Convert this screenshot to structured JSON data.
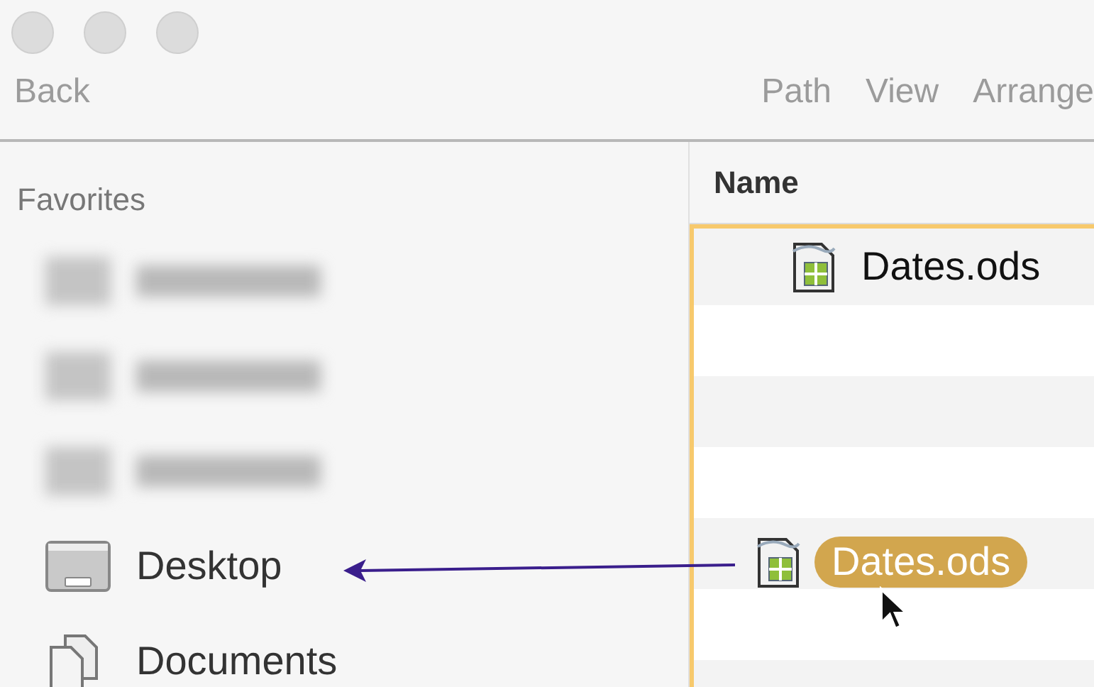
{
  "toolbar": {
    "back": "Back",
    "items": [
      "Path",
      "View",
      "Arrange"
    ]
  },
  "sidebar": {
    "section": "Favorites",
    "items": [
      {
        "kind": "blurred"
      },
      {
        "kind": "blurred"
      },
      {
        "kind": "blurred"
      },
      {
        "kind": "desktop",
        "label": "Desktop"
      },
      {
        "kind": "documents",
        "label": "Documents"
      }
    ]
  },
  "file_list": {
    "column": "Name",
    "files": [
      {
        "name": "Dates.ods"
      }
    ],
    "drag": {
      "name": "Dates.ods"
    }
  }
}
